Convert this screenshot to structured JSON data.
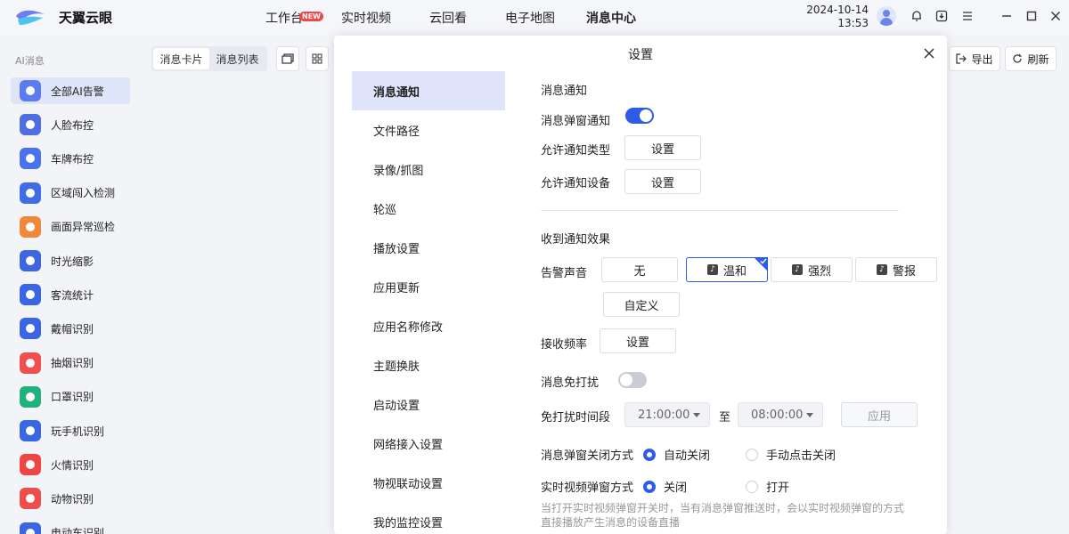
{
  "app": {
    "name": "天翼云眼"
  },
  "nav": {
    "items": [
      {
        "label": "工作台",
        "badge": "NEW"
      },
      {
        "label": "实时视频"
      },
      {
        "label": "云回看"
      },
      {
        "label": "电子地图"
      },
      {
        "label": "消息中心",
        "active": true
      }
    ]
  },
  "header": {
    "date": "2024-10-14",
    "time": "13:53"
  },
  "sidebar": {
    "title": "AI消息",
    "items": [
      {
        "label": "全部AI告警",
        "color": "#5b7cf0",
        "active": true
      },
      {
        "label": "人脸布控",
        "color": "#4f6fe0"
      },
      {
        "label": "车牌布控",
        "color": "#4a73e8"
      },
      {
        "label": "区域闯入检测",
        "color": "#3e6de6"
      },
      {
        "label": "画面异常巡检",
        "color": "#f0883a"
      },
      {
        "label": "时光缩影",
        "color": "#3c67e0"
      },
      {
        "label": "客流统计",
        "color": "#3a66e4"
      },
      {
        "label": "戴帽识别",
        "color": "#3a66e4"
      },
      {
        "label": "抽烟识别",
        "color": "#ef4f4f"
      },
      {
        "label": "口罩识别",
        "color": "#22b07d"
      },
      {
        "label": "玩手机识别",
        "color": "#3a66e4"
      },
      {
        "label": "火情识别",
        "color": "#f04545"
      },
      {
        "label": "动物识别",
        "color": "#ec4d4d"
      },
      {
        "label": "电动车识别",
        "color": "#3a66e4"
      }
    ]
  },
  "toolbar": {
    "tabs": [
      {
        "label": "消息卡片",
        "active": true
      },
      {
        "label": "消息列表"
      }
    ],
    "export_label": "导出",
    "refresh_label": "刷新"
  },
  "modal": {
    "title": "设置",
    "menu": [
      {
        "label": "消息通知",
        "active": true
      },
      {
        "label": "文件路径"
      },
      {
        "label": "录像/抓图"
      },
      {
        "label": "轮巡"
      },
      {
        "label": "播放设置"
      },
      {
        "label": "应用更新"
      },
      {
        "label": "应用名称修改"
      },
      {
        "label": "主题换肤"
      },
      {
        "label": "启动设置"
      },
      {
        "label": "网络接入设置"
      },
      {
        "label": "物视联动设置"
      },
      {
        "label": "我的监控设置"
      }
    ],
    "notify": {
      "section_title": "消息通知",
      "popup_label": "消息弹窗通知",
      "popup_on": true,
      "type_label": "允许通知类型",
      "type_button": "设置",
      "device_label": "允许通知设备",
      "device_button": "设置"
    },
    "effect": {
      "section_title": "收到通知效果",
      "sound_label": "告警声音",
      "sounds": [
        {
          "label": "无",
          "icon": ""
        },
        {
          "label": "温和",
          "icon": "music-note-icon",
          "selected": true
        },
        {
          "label": "强烈",
          "icon": "music-note-icon"
        },
        {
          "label": "警报",
          "icon": "music-note-icon"
        }
      ],
      "custom_label": "自定义",
      "freq_label": "接收频率",
      "freq_button": "设置",
      "dnd_label": "消息免打扰",
      "dnd_on": false,
      "dnd_time_label": "免打扰时间段",
      "dnd_start": "21:00:00",
      "dnd_to": "至",
      "dnd_end": "08:00:00",
      "apply_label": "应用",
      "close_mode_label": "消息弹窗关闭方式",
      "close_modes": [
        {
          "label": "自动关闭",
          "checked": true
        },
        {
          "label": "手动点击关闭",
          "checked": false
        }
      ],
      "live_mode_label": "实时视频弹窗方式",
      "live_modes": [
        {
          "label": "关闭",
          "checked": true
        },
        {
          "label": "打开",
          "checked": false
        }
      ],
      "hint_line1": "当打开实时视频弹窗开关时，当有消息弹窗推送时，会以实时视频弹窗的方式",
      "hint_line2": "直接播放产生消息的设备直播"
    }
  }
}
